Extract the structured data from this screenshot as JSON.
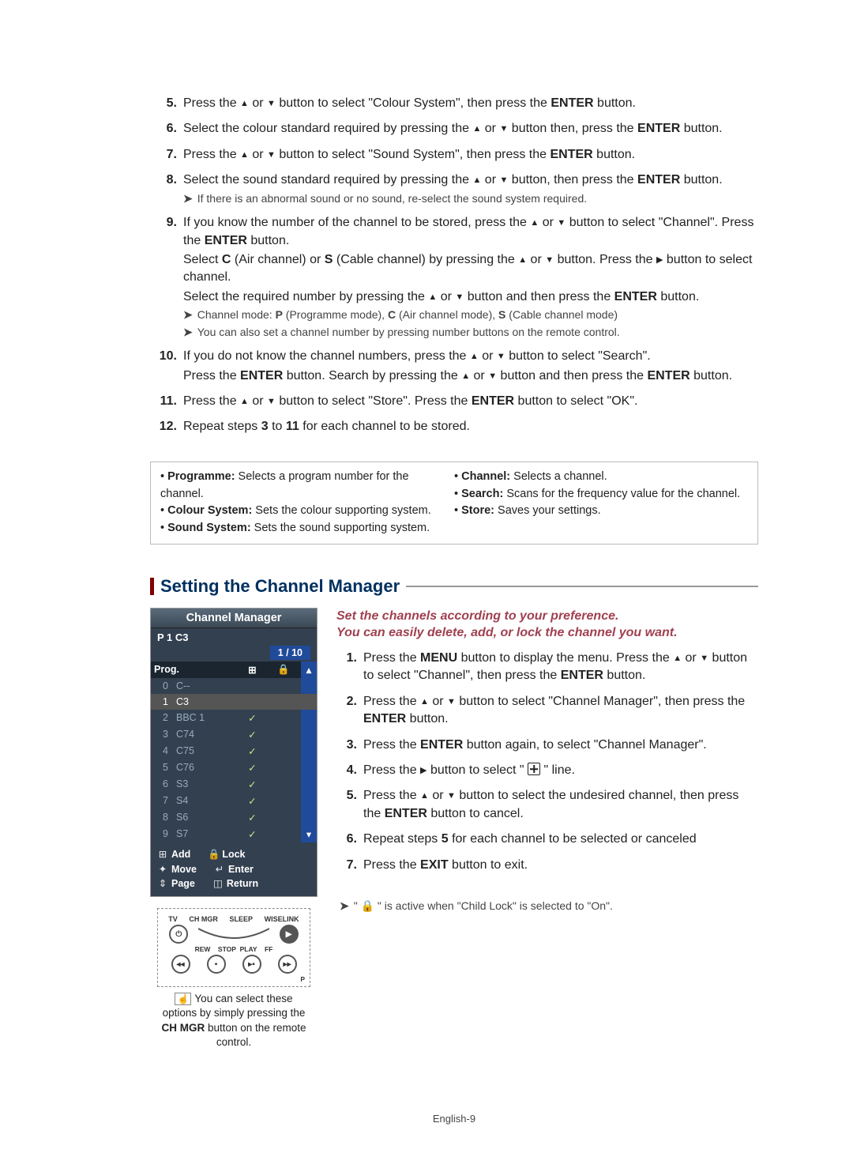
{
  "glyph": {
    "up": "▲",
    "down": "▼",
    "right": "▶",
    "arrow_note": "➤",
    "check": "✓",
    "lock": "🔒",
    "hand": "☝"
  },
  "steps": [
    {
      "n": "5.",
      "lines": [
        "Press the {UP} or {DOWN} button to select \"Colour System\", then press the {B}ENTER{/B} button."
      ]
    },
    {
      "n": "6.",
      "lines": [
        "Select the colour standard required by pressing the {UP} or {DOWN} button then, press the {B}ENTER{/B} button."
      ]
    },
    {
      "n": "7.",
      "lines": [
        "Press the {UP} or {DOWN} button to select \"Sound System\", then press the {B}ENTER{/B} button."
      ]
    },
    {
      "n": "8.",
      "lines": [
        "Select the sound standard required by pressing the {UP} or {DOWN} button, then press the {B}ENTER{/B} button."
      ],
      "notes": [
        "If there is an abnormal sound or no sound, re-select the sound system required."
      ]
    },
    {
      "n": "9.",
      "lines": [
        "If you know the number of the channel to be stored, press the {UP} or {DOWN} button to select \"Channel\". Press the {B}ENTER{/B} button.",
        "Select {B}C{/B} (Air channel) or {B}S{/B} (Cable channel) by pressing the {UP} or {DOWN} button. Press the {RIGHT} button to select channel.",
        "Select the required number by pressing the {UP} or {DOWN} button and then press the {B}ENTER{/B} button."
      ],
      "notes": [
        "Channel mode: {B}P{/B} (Programme mode), {B}C{/B} (Air channel mode), {B}S{/B} (Cable channel mode)",
        "You can also set a channel number by pressing number buttons on the remote control."
      ]
    },
    {
      "n": "10.",
      "lines": [
        "If you do not know the channel numbers, press the {UP} or {DOWN} button to select \"Search\".",
        "Press the {B}ENTER{/B} button. Search by pressing the {UP} or {DOWN} button and then press the {B}ENTER{/B} button."
      ]
    },
    {
      "n": "11.",
      "lines": [
        "Press the {UP} or {DOWN} button to select \"Store\". Press the {B}ENTER{/B} button to select \"OK\"."
      ]
    },
    {
      "n": "12.",
      "lines": [
        "Repeat steps {B}3{/B} to {B}11{/B} for each channel to be stored."
      ]
    }
  ],
  "defs": {
    "left": [
      {
        "term": "Programme:",
        "desc": "Selects a program number for the channel."
      },
      {
        "term": "Colour System:",
        "desc": "Sets the colour supporting system."
      },
      {
        "term": "Sound System:",
        "desc": "Sets the sound supporting system."
      }
    ],
    "right": [
      {
        "term": "Channel:",
        "desc": "Selects a channel."
      },
      {
        "term": "Search:",
        "desc": "Scans for the frequency value for the channel."
      },
      {
        "term": "Store:",
        "desc": "Saves your settings."
      }
    ]
  },
  "section_title": "Setting the Channel Manager",
  "intro": [
    "Set the channels according to your preference.",
    "You can easily delete, add, or lock the channel you want."
  ],
  "steps2": [
    {
      "n": "1.",
      "lines": [
        "Press the {B}MENU{/B} button to display the menu.  Press the {UP} or {DOWN} button to select \"Channel\", then press the {B}ENTER{/B} button."
      ]
    },
    {
      "n": "2.",
      "lines": [
        "Press the {UP} or {DOWN} button to select \"Channel Manager\", then press the {B}ENTER{/B} button."
      ]
    },
    {
      "n": "3.",
      "lines": [
        "Press the {B}ENTER{/B} button again, to select \"Channel Manager\"."
      ]
    },
    {
      "n": "4.",
      "lines": [
        "Press the {RIGHT} button to select \" {PLUS} \" line."
      ]
    },
    {
      "n": "5.",
      "lines": [
        "Press the {UP} or {DOWN} button to select the undesired channel, then press the {B}ENTER{/B} button to cancel."
      ]
    },
    {
      "n": "6.",
      "lines": [
        "Repeat steps {B}5{/B} for each channel to be selected or canceled"
      ]
    },
    {
      "n": "7.",
      "lines": [
        "Press the {B}EXIT{/B} button to exit."
      ]
    }
  ],
  "lock_note": "\" {LOCK} \" is active when \"Child Lock\" is selected to \"On\".",
  "osd": {
    "title": "Channel Manager",
    "sub": "P 1   C3",
    "paging": "1 / 10",
    "cols": {
      "prog": "Prog.",
      "add": "⊞",
      "lock": "🔒"
    },
    "rows": [
      {
        "idx": "0",
        "name": "C--",
        "chk": false,
        "sel": false
      },
      {
        "idx": "1",
        "name": "C3",
        "chk": false,
        "sel": true
      },
      {
        "idx": "2",
        "name": "BBC 1",
        "chk": true,
        "sel": false
      },
      {
        "idx": "3",
        "name": "C74",
        "chk": true,
        "sel": false
      },
      {
        "idx": "4",
        "name": "C75",
        "chk": true,
        "sel": false
      },
      {
        "idx": "5",
        "name": "C76",
        "chk": true,
        "sel": false
      },
      {
        "idx": "6",
        "name": "S3",
        "chk": true,
        "sel": false
      },
      {
        "idx": "7",
        "name": "S4",
        "chk": true,
        "sel": false
      },
      {
        "idx": "8",
        "name": "S6",
        "chk": true,
        "sel": false
      },
      {
        "idx": "9",
        "name": "S7",
        "chk": true,
        "sel": false
      }
    ],
    "legend": {
      "add": "Add",
      "lock": "Lock",
      "move": "Move",
      "enter": "Enter",
      "page": "Page",
      "return": "Return"
    }
  },
  "remote_note": "You can select these options  by simply pressing the  {B}CH MGR{/B} button on the remote control.",
  "remote_labels": {
    "tv": "TV",
    "chmgr": "CH MGR",
    "sleep": "SLEEP",
    "wiselink": "WISELINK",
    "rew": "REW",
    "stop": "STOP",
    "play": "PLAY",
    "ff": "FF",
    "p": "P"
  },
  "footer": "English-9"
}
